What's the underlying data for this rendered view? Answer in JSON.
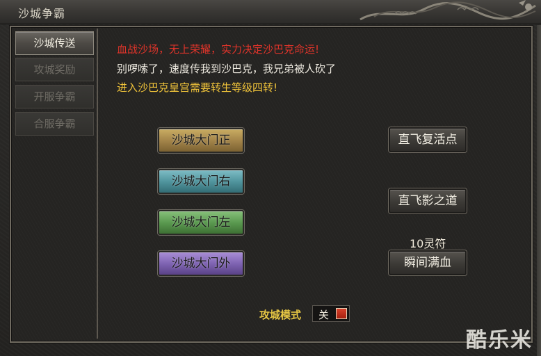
{
  "window": {
    "title": "沙城争霸"
  },
  "sidebar": {
    "items": [
      {
        "label": "沙城传送",
        "state": "active"
      },
      {
        "label": "攻城奖励",
        "state": "disabled"
      },
      {
        "label": "开服争霸",
        "state": "disabled"
      },
      {
        "label": "合服争霸",
        "state": "disabled"
      }
    ]
  },
  "info": {
    "line1": "血战沙场，无上荣耀，实力决定沙巴克命运!",
    "line2": "别啰嗦了，速度传我到沙巴克，我兄弟被人砍了",
    "line3": "进入沙巴克皇宫需要转生等级四转!"
  },
  "teleports": {
    "front": "沙城大门正",
    "right": "沙城大门右",
    "left": "沙城大门左",
    "outside": "沙城大门外"
  },
  "actions": {
    "revive_point": "直飞复活点",
    "shadow_path": "直飞影之道",
    "cost_label": "10灵符",
    "instant_heal": "瞬间满血"
  },
  "siege_mode": {
    "label": "攻城模式",
    "value": "关"
  },
  "watermark": "酷乐米",
  "colors": {
    "line1": "#e0342a",
    "line2": "#f0ece2",
    "line3": "#f2c53a"
  }
}
